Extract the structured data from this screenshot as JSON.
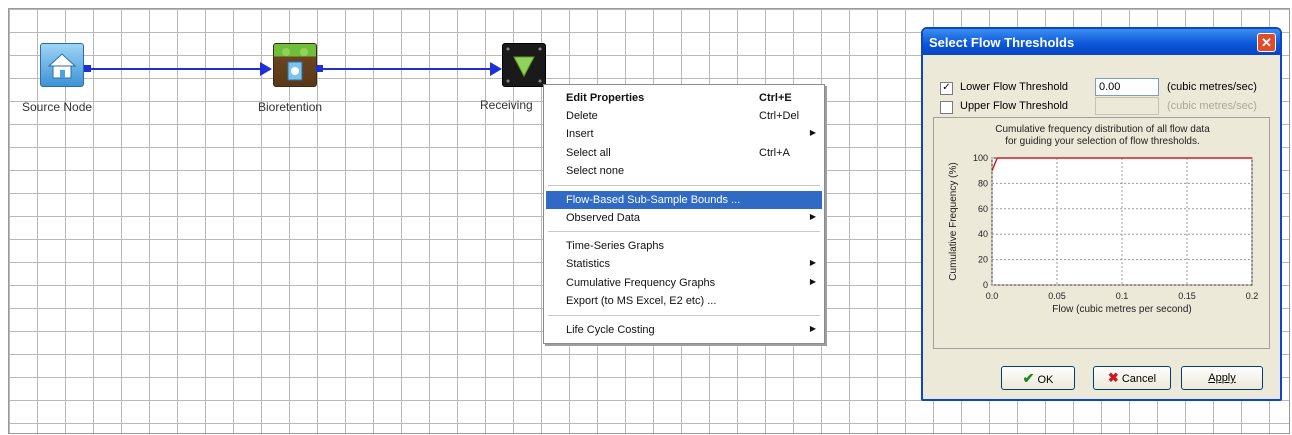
{
  "nodes": [
    {
      "label": "Source Node"
    },
    {
      "label": "Bioretention"
    },
    {
      "label": "Receiving"
    }
  ],
  "context_menu": {
    "items": [
      {
        "label": "Edit Properties",
        "shortcut": "Ctrl+E"
      },
      {
        "label": "Delete",
        "shortcut": "Ctrl+Del"
      },
      {
        "label": "Insert"
      },
      {
        "label": "Select all",
        "shortcut": "Ctrl+A"
      },
      {
        "label": "Select none"
      },
      {
        "label": "Flow-Based Sub-Sample Bounds ..."
      },
      {
        "label": "Observed Data"
      },
      {
        "label": "Time-Series Graphs"
      },
      {
        "label": "Statistics"
      },
      {
        "label": "Cumulative Frequency Graphs"
      },
      {
        "label": "Export  (to MS Excel, E2 etc) ..."
      },
      {
        "label": "Life Cycle Costing"
      }
    ]
  },
  "dialog": {
    "title": "Select Flow Thresholds",
    "close_glyph": "✕",
    "check_glyph": "✓",
    "lower": {
      "label": "Lower Flow Threshold",
      "value": "0.00",
      "unit": "(cubic metres/sec)",
      "checked": true
    },
    "upper": {
      "label": "Upper Flow Threshold",
      "value": "",
      "unit": "(cubic metres/sec)",
      "checked": false
    },
    "chart_caption_1": "Cumulative frequency distribution of all flow data",
    "chart_caption_2": "for guiding your selection of flow thresholds.",
    "buttons": {
      "ok": "OK",
      "cancel": "Cancel",
      "apply": "Apply"
    }
  },
  "colors": {
    "link": "#1f2fd6",
    "highlight": "#316ac5",
    "title_bar": "#0a55d9",
    "curve": "#cc2222"
  },
  "chart_data": {
    "type": "line",
    "xlabel": "Flow (cubic metres per second)",
    "ylabel": "Cumulative Frequency (%)",
    "xlim": [
      0,
      0.2
    ],
    "ylim": [
      0,
      100
    ],
    "x_ticks": [
      "0.0",
      "0.05",
      "0.1",
      "0.15",
      "0.2"
    ],
    "y_ticks": [
      "0",
      "20",
      "40",
      "60",
      "80",
      "100"
    ],
    "grid": true,
    "series": [
      {
        "x": [
          0,
          0.004,
          0.2
        ],
        "y": [
          90,
          100,
          100
        ]
      }
    ]
  }
}
